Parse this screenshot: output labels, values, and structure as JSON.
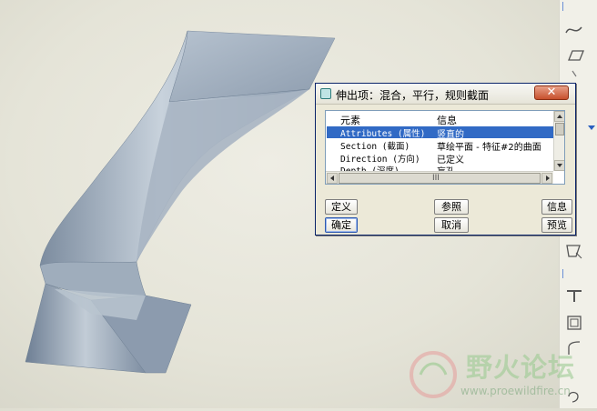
{
  "dialog": {
    "title": "伸出项：混合，平行，规则截面",
    "close_symbol": "✕",
    "columns": {
      "element": "元素",
      "info": "信息"
    },
    "rows": [
      {
        "element": "Attributes (属性)",
        "info": "竖直的",
        "selected": true
      },
      {
        "element": "Section (截面)",
        "info": "草绘平面 - 特征#2的曲面",
        "selected": false
      },
      {
        "element": "Direction (方向)",
        "info": "已定义",
        "selected": false
      },
      {
        "element": "Depth (深度)",
        "info": "盲孔",
        "selected": false
      }
    ],
    "hscroll_grip": "III",
    "buttons": {
      "define": "定义",
      "reference": "参照",
      "info": "信息",
      "ok": "确定",
      "cancel": "取消",
      "preview": "预览"
    }
  },
  "toolbar_icons": [
    "sketch-curve-icon",
    "datum-plane-icon",
    "datum-axis-icon",
    "sweep-icon",
    "round-icon",
    "shell-icon",
    "draft-icon",
    "undo-icon"
  ],
  "watermark": {
    "text": "野火论坛",
    "url": "www.proewildfire.cn"
  },
  "colors": {
    "selection": "#316ac5",
    "close_button": "#c7502c",
    "model_surface": "#9aa9ba",
    "background": "#e8e7dc"
  }
}
